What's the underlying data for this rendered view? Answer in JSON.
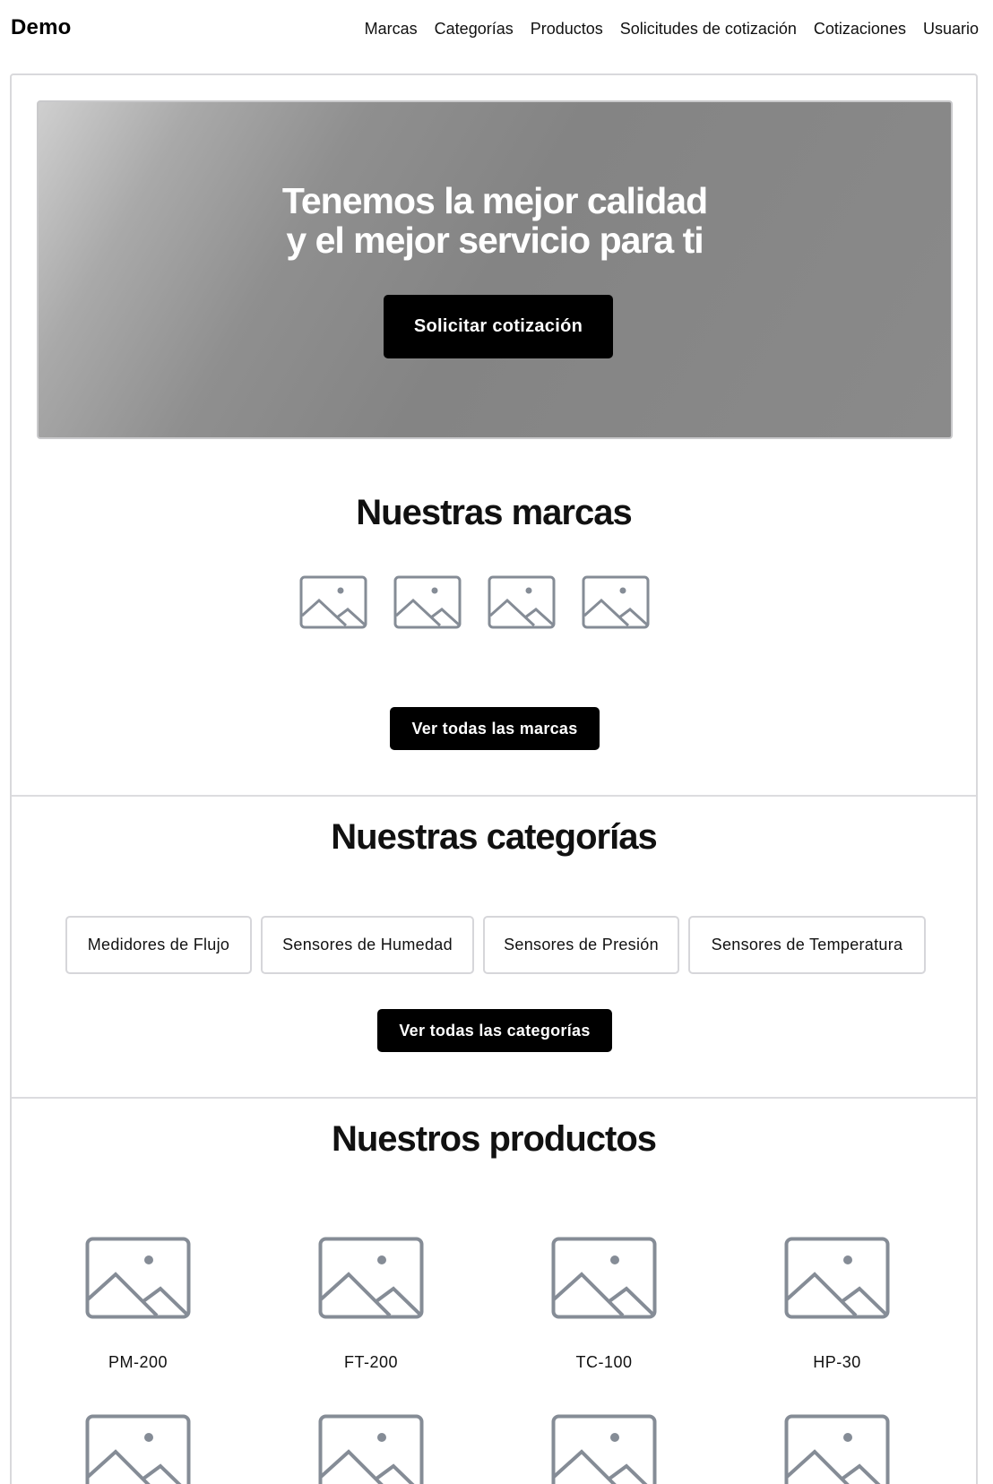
{
  "header": {
    "brand": "Demo",
    "nav": [
      "Marcas",
      "Categorías",
      "Productos",
      "Solicitudes de cotización",
      "Cotizaciones",
      "Usuario"
    ]
  },
  "hero": {
    "title_line1": "Tenemos la mejor calidad",
    "title_line2": "y el mejor servicio para ti",
    "cta": "Solicitar cotización"
  },
  "brands": {
    "title": "Nuestras marcas",
    "logo_icon": "image-placeholder-icon",
    "logo_count": 4,
    "cta": "Ver todas las marcas"
  },
  "categories": {
    "title": "Nuestras categorías",
    "items": [
      "Medidores de Flujo",
      "Sensores de Humedad",
      "Sensores de Presión",
      "Sensores de Temperatura"
    ],
    "cta": "Ver todas las categorías"
  },
  "products": {
    "title": "Nuestros productos",
    "image_icon": "image-placeholder-icon",
    "items": [
      "PM-200",
      "FT-200",
      "TC-100",
      "HP-30"
    ]
  },
  "colors": {
    "button_bg": "#000000",
    "icon_stroke": "#858c96",
    "border": "#d9d9dc"
  }
}
